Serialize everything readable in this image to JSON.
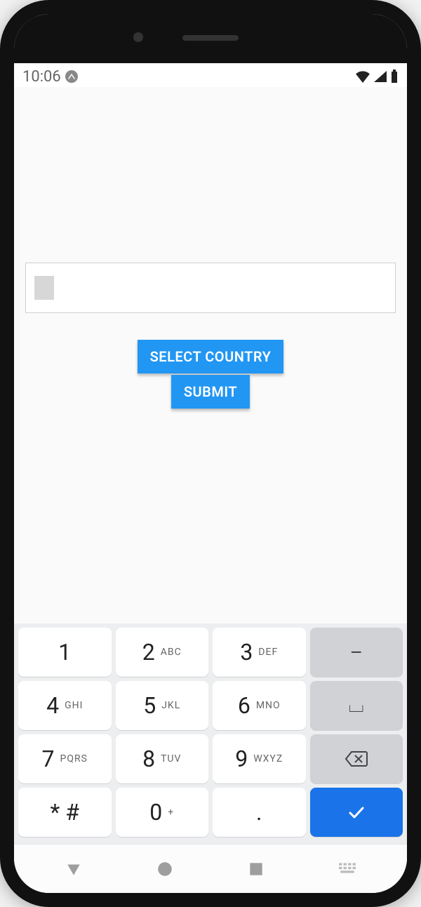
{
  "statusbar": {
    "time": "10:06"
  },
  "form": {
    "input_value": "",
    "select_country_label": "SELECT COUNTRY",
    "submit_label": "SUBMIT"
  },
  "keyboard": {
    "rows": [
      [
        {
          "d": "1",
          "l": ""
        },
        {
          "d": "2",
          "l": "ABC"
        },
        {
          "d": "3",
          "l": "DEF"
        },
        {
          "action": "dash"
        }
      ],
      [
        {
          "d": "4",
          "l": "GHI"
        },
        {
          "d": "5",
          "l": "JKL"
        },
        {
          "d": "6",
          "l": "MNO"
        },
        {
          "action": "space"
        }
      ],
      [
        {
          "d": "7",
          "l": "PQRS"
        },
        {
          "d": "8",
          "l": "TUV"
        },
        {
          "d": "9",
          "l": "WXYZ"
        },
        {
          "action": "backspace"
        }
      ],
      [
        {
          "d": "* #",
          "l": ""
        },
        {
          "d": "0",
          "l": "+"
        },
        {
          "d": ".",
          "l": ""
        },
        {
          "action": "enter"
        }
      ]
    ],
    "action_glyphs": {
      "dash": "–",
      "space": "⌴"
    }
  }
}
